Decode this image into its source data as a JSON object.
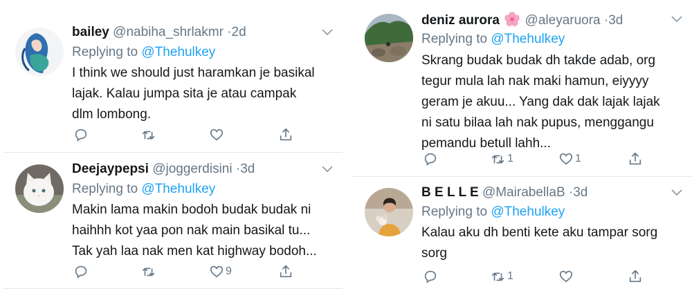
{
  "tweets_left": [
    {
      "name": "bailey",
      "handle": "@nabiha_shrlakmr",
      "dot": "·",
      "time": "2d",
      "replying_prefix": "Replying to ",
      "replying_to": "@Thehulkey",
      "text": "I think we should just haramkan je basikal\nlajak. Kalau jumpa sita je atau campak\ndlm lombong.",
      "reply_count": "",
      "retweet_count": "",
      "like_count": ""
    },
    {
      "name": "Deejaypepsi",
      "handle": "@joggerdisini",
      "dot": "·",
      "time": "3d",
      "replying_prefix": "Replying to ",
      "replying_to": "@Thehulkey",
      "text": "Makin lama makin bodoh budak budak ni\nhaihhh kot yaa pon nak main basikal tu...\nTak yah laa nak men kat highway bodoh...",
      "reply_count": "",
      "retweet_count": "",
      "like_count": "9"
    }
  ],
  "tweets_right": [
    {
      "name": "deniz aurora",
      "name_emoji": "cherry-blossom-icon",
      "handle": "@aleyaruora",
      "dot": "·",
      "time": "3d",
      "replying_prefix": "Replying to ",
      "replying_to": "@Thehulkey",
      "text": "Skrang budak budak dh takde adab,  org\ntegur mula lah nak maki hamun,  eiyyyy\ngeram je akuu... Yang dak dak lajak lajak\nni satu bilaa lah nak pupus,  menggangu\npemandu betull lahh...",
      "reply_count": "",
      "retweet_count": "1",
      "like_count": "1"
    },
    {
      "name": "B E L L E",
      "handle": "@MairabellaB",
      "dot": "·",
      "time": "3d",
      "replying_prefix": "Replying to ",
      "replying_to": "@Thehulkey",
      "text": "Kalau aku dh benti kete aku tampar sorg\nsorg",
      "reply_count": "",
      "retweet_count": "1",
      "like_count": ""
    }
  ],
  "icons": {
    "reply": "reply-icon",
    "retweet": "retweet-icon",
    "like": "heart-icon",
    "share": "share-icon",
    "more": "chevron-down-icon"
  },
  "colors": {
    "mention": "#1da1f2",
    "muted": "#657786",
    "divider": "#e1e8ed",
    "text": "#14171a"
  }
}
